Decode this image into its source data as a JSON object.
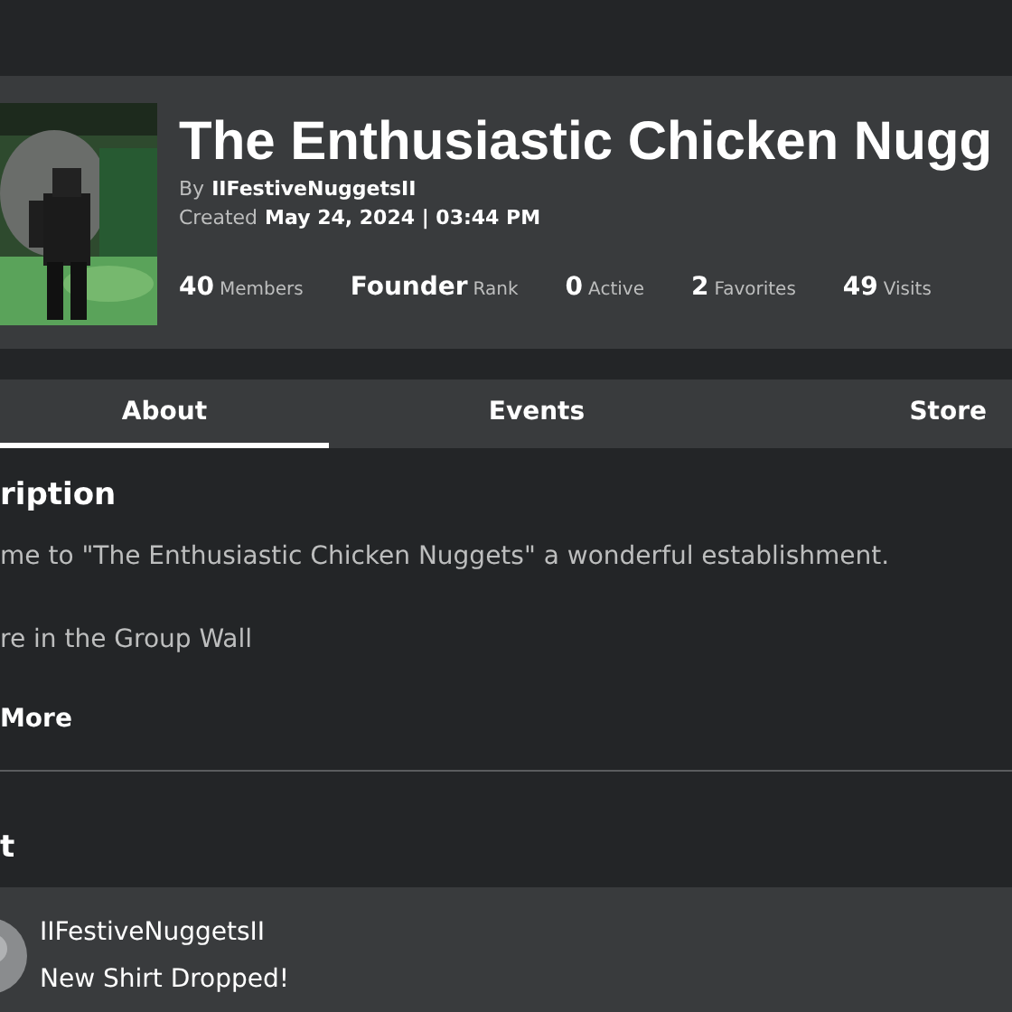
{
  "group": {
    "name": "The Enthusiastic Chicken Nugg",
    "by_label": "By",
    "owner": "IIFestiveNuggetsII",
    "created_label": "Created",
    "created": "May 24, 2024 | 03:44 PM",
    "stats": [
      {
        "value": "40",
        "label": "Members"
      },
      {
        "value": "Founder",
        "label": "Rank"
      },
      {
        "value": "0",
        "label": "Active"
      },
      {
        "value": "2",
        "label": "Favorites"
      },
      {
        "value": "49",
        "label": "Visits"
      }
    ]
  },
  "tabs": [
    {
      "label": "About",
      "selected": true
    },
    {
      "label": "Events",
      "selected": false
    },
    {
      "label": "Store",
      "selected": false
    }
  ],
  "description": {
    "heading": "ription",
    "lines": [
      "me to \"The Enthusiastic Chicken Nuggets\" a wonderful establishment.",
      "re in the Group Wall"
    ],
    "more": "More"
  },
  "shout": {
    "heading": "t",
    "author": "IIFestiveNuggetsII",
    "message": "New Shirt Dropped!"
  }
}
